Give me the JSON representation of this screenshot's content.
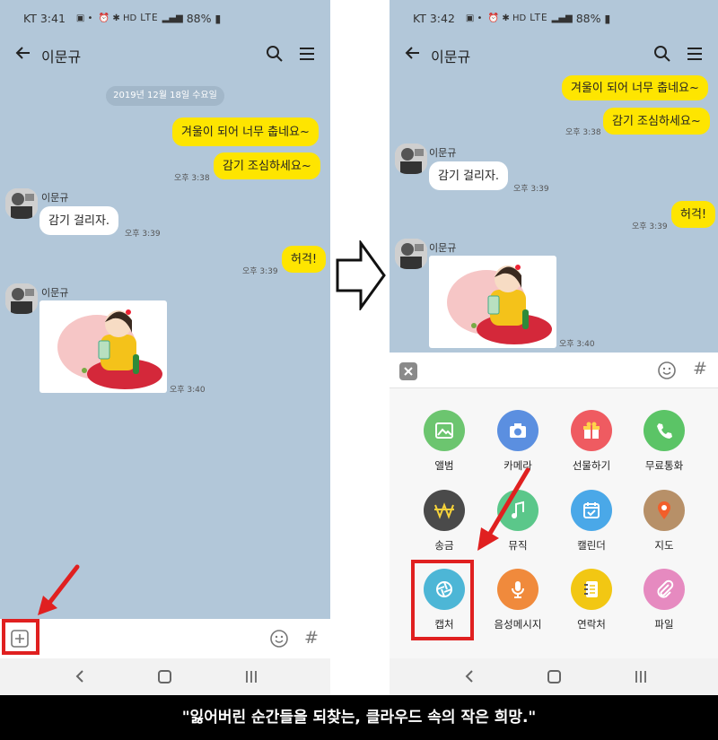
{
  "left": {
    "status": {
      "carrier_time": "KT 3:41",
      "icons": "LTE",
      "battery": "88%"
    },
    "header": {
      "title": "이문규"
    },
    "date_chip": "2019년 12월 18일 수요일",
    "messages": [
      {
        "text": "겨울이 되어 너무 춥네요~"
      },
      {
        "text": "감기 조심하세요~",
        "time": "오후 3:38"
      },
      {
        "sender": "이문규",
        "text": "감기 걸리자.",
        "time": "오후 3:39"
      },
      {
        "text": "허걱!",
        "time": "오후 3:39"
      },
      {
        "sender": "이문규",
        "time": "오후 3:40"
      }
    ]
  },
  "right": {
    "status": {
      "carrier_time": "KT 3:42",
      "icons": "LTE",
      "battery": "88%"
    },
    "header": {
      "title": "이문규"
    },
    "messages": [
      {
        "text": "겨울이 되어 너무 춥네요~"
      },
      {
        "text": "감기 조심하세요~",
        "time": "오후 3:38"
      },
      {
        "sender": "이문규",
        "text": "감기 걸리자.",
        "time": "오후 3:39"
      },
      {
        "text": "허걱!",
        "time": "오후 3:39"
      },
      {
        "sender": "이문규",
        "time": "오후 3:40"
      }
    ],
    "panel_items": [
      {
        "label": "앨범",
        "icon": "image-icon",
        "color": "#6cc56f"
      },
      {
        "label": "카메라",
        "icon": "camera-icon",
        "color": "#5b8fe0"
      },
      {
        "label": "선물하기",
        "icon": "gift-icon",
        "color": "#ef5b61"
      },
      {
        "label": "무료통화",
        "icon": "phone-icon",
        "color": "#5bc466"
      },
      {
        "label": "송금",
        "icon": "won-icon",
        "color": "#4a4a4a"
      },
      {
        "label": "뮤직",
        "icon": "music-icon",
        "color": "#5bc78a"
      },
      {
        "label": "캘린더",
        "icon": "calendar-icon",
        "color": "#4aa8e8"
      },
      {
        "label": "지도",
        "icon": "map-pin-icon",
        "color": "#b79068"
      },
      {
        "label": "캡처",
        "icon": "capture-icon",
        "color": "#4db6d6"
      },
      {
        "label": "음성메시지",
        "icon": "microphone-icon",
        "color": "#f08a3c"
      },
      {
        "label": "연락처",
        "icon": "contacts-icon",
        "color": "#f2c713"
      },
      {
        "label": "파일",
        "icon": "paperclip-icon",
        "color": "#e68ac0"
      }
    ]
  },
  "caption": "\"잃어버린 순간들을 되찾는, 클라우드 속의 작은 희망.\"",
  "colors": {
    "accent_red": "#e02020",
    "bubble_yellow": "#fee500",
    "chat_bg": "#b2c7d9"
  }
}
